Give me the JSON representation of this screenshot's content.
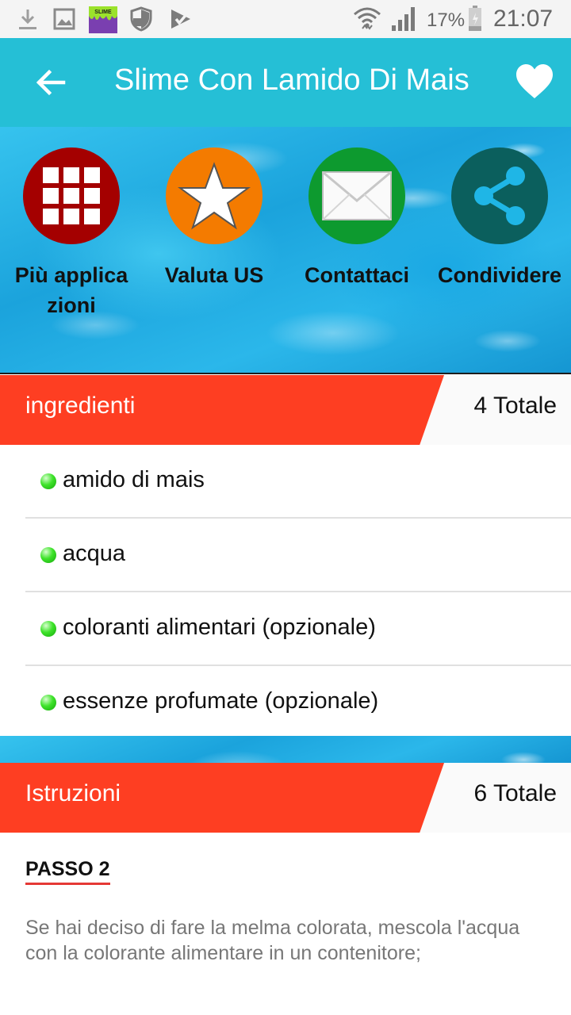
{
  "status_bar": {
    "battery_percent": "17%",
    "time": "21:07",
    "icons": [
      "download-icon",
      "image-icon",
      "slime-app-icon",
      "shield-icon",
      "check-icon",
      "wifi-icon",
      "signal-icon",
      "battery-icon"
    ]
  },
  "app_bar": {
    "title": "Slime Con Lamido Di Mais",
    "back_icon": "arrow-left-icon",
    "favorite_icon": "heart-icon"
  },
  "menu": [
    {
      "label": "Più applicazioni",
      "icon": "grid-icon",
      "color": "#a40000"
    },
    {
      "label": "Valuta US",
      "icon": "star-icon",
      "color": "#f47b00"
    },
    {
      "label": "Contattaci",
      "icon": "mail-icon",
      "color": "#0d9a2f"
    },
    {
      "label": "Condividere",
      "icon": "share-icon",
      "color": "#0b5f5d"
    }
  ],
  "ingredients": {
    "header": "ingredienti",
    "count": "4 Totale",
    "items": [
      "amido di mais",
      "acqua",
      "coloranti alimentari (opzionale)",
      "essenze profumate (opzionale)"
    ]
  },
  "instructions": {
    "header": "Istruzioni",
    "count": "6 Totale",
    "step_title": "PASSO 2",
    "step_text": "Se hai deciso di fare la melma colorata, mescola l'acqua con la colorante alimentare in un contenitore;"
  },
  "colors": {
    "app_bar": "#25bfd6",
    "section_header": "#fe3e22",
    "ingredient_dot": "#3ee32a",
    "step_underline": "#e53935"
  }
}
